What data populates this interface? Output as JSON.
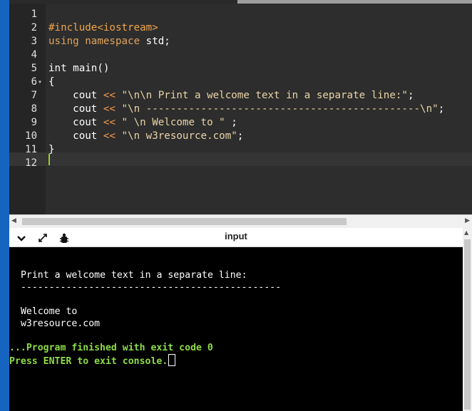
{
  "editor": {
    "lines": [
      {
        "num": "1",
        "parts": []
      },
      {
        "num": "2",
        "parts": [
          {
            "t": "#include",
            "c": "pp"
          },
          {
            "t": "<iostream>",
            "c": "pp"
          }
        ]
      },
      {
        "num": "3",
        "parts": [
          {
            "t": "using namespace",
            "c": "kw"
          },
          {
            "t": " std;",
            "c": "plain"
          }
        ]
      },
      {
        "num": "4",
        "parts": []
      },
      {
        "num": "5",
        "parts": [
          {
            "t": "int",
            "c": "plain"
          },
          {
            "t": " main()",
            "c": "plain"
          }
        ]
      },
      {
        "num": "6",
        "fold": "▾",
        "parts": [
          {
            "t": "{",
            "c": "plain"
          }
        ]
      },
      {
        "num": "7",
        "parts": [
          {
            "t": "    cout ",
            "c": "plain"
          },
          {
            "t": "<<",
            "c": "op"
          },
          {
            "t": " \"\\n\\n Print a welcome text in a separate line:\"",
            "c": "str"
          },
          {
            "t": ";",
            "c": "plain"
          }
        ]
      },
      {
        "num": "8",
        "parts": [
          {
            "t": "    cout ",
            "c": "plain"
          },
          {
            "t": "<<",
            "c": "op"
          },
          {
            "t": " \"\\n ---------------------------------------------\\n\"",
            "c": "str"
          },
          {
            "t": ";",
            "c": "plain"
          }
        ]
      },
      {
        "num": "9",
        "parts": [
          {
            "t": "    cout ",
            "c": "plain"
          },
          {
            "t": "<<",
            "c": "op"
          },
          {
            "t": " \" \\n Welcome to \"",
            "c": "str"
          },
          {
            "t": " ;",
            "c": "plain"
          }
        ]
      },
      {
        "num": "10",
        "parts": [
          {
            "t": "    cout ",
            "c": "plain"
          },
          {
            "t": "<<",
            "c": "op"
          },
          {
            "t": " \"\\n w3resource.com\"",
            "c": "str"
          },
          {
            "t": ";",
            "c": "plain"
          }
        ]
      },
      {
        "num": "11",
        "parts": [
          {
            "t": "}",
            "c": "plain"
          }
        ]
      },
      {
        "num": "12",
        "parts": []
      }
    ]
  },
  "console_panel": {
    "title": "input",
    "icons": [
      "chevron-down-icon",
      "expand-icon",
      "debug-icon"
    ]
  },
  "console": {
    "output_line1": " Print a welcome text in a separate line:",
    "output_line2": " ----------------------------------------------",
    "output_line3": " Welcome to",
    "output_line4": " w3resource.com",
    "finished": "...Program finished with exit code 0",
    "prompt": "Press ENTER to exit console."
  },
  "colors": {
    "accent_rail": "#1565c0",
    "console_finished": "#8ddc43",
    "editor_bg": "#2d2d2d"
  }
}
